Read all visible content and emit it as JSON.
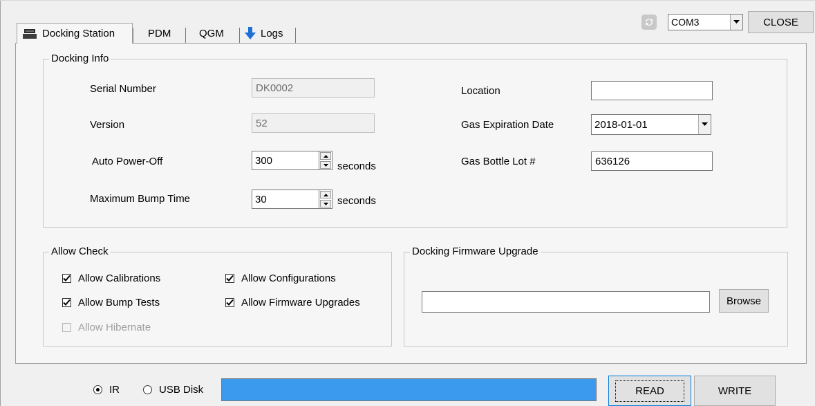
{
  "tabs": [
    {
      "label": "Docking Station",
      "icon": "docking-station-icon",
      "active": true
    },
    {
      "label": "PDM",
      "active": false
    },
    {
      "label": "QGM",
      "active": false
    },
    {
      "label": "Logs",
      "icon": "download-arrow-icon",
      "active": false
    }
  ],
  "port": {
    "selected": "COM3"
  },
  "close_label": "CLOSE",
  "docking_info": {
    "title": "Docking Info",
    "serial_label": "Serial Number",
    "serial_value": "DK0002",
    "version_label": "Version",
    "version_value": "52",
    "auto_power_off_label": "Auto Power-Off",
    "auto_power_off_value": "300",
    "max_bump_label": "Maximum Bump Time",
    "max_bump_value": "30",
    "seconds_label": "seconds",
    "location_label": "Location",
    "location_value": "",
    "gas_exp_label": "Gas Expiration Date",
    "gas_exp_value": "2018-01-01",
    "gas_lot_label": "Gas Bottle Lot #",
    "gas_lot_value": "636126"
  },
  "allow_check": {
    "title": "Allow Check",
    "items": [
      {
        "label": "Allow Calibrations",
        "checked": true,
        "enabled": true
      },
      {
        "label": "Allow Configurations",
        "checked": true,
        "enabled": true
      },
      {
        "label": "Allow Bump Tests",
        "checked": true,
        "enabled": true
      },
      {
        "label": "Allow Firmware Upgrades",
        "checked": true,
        "enabled": true
      },
      {
        "label": "Allow Hibernate",
        "checked": false,
        "enabled": false
      }
    ]
  },
  "firmware": {
    "title": "Docking Firmware Upgrade",
    "path_value": "",
    "browse_label": "Browse"
  },
  "transport": {
    "ir_label": "IR",
    "usb_label": "USB Disk",
    "selected": "IR"
  },
  "progress": {
    "value": 1.0,
    "color": "#3c9aee"
  },
  "read_label": "READ",
  "write_label": "WRITE"
}
